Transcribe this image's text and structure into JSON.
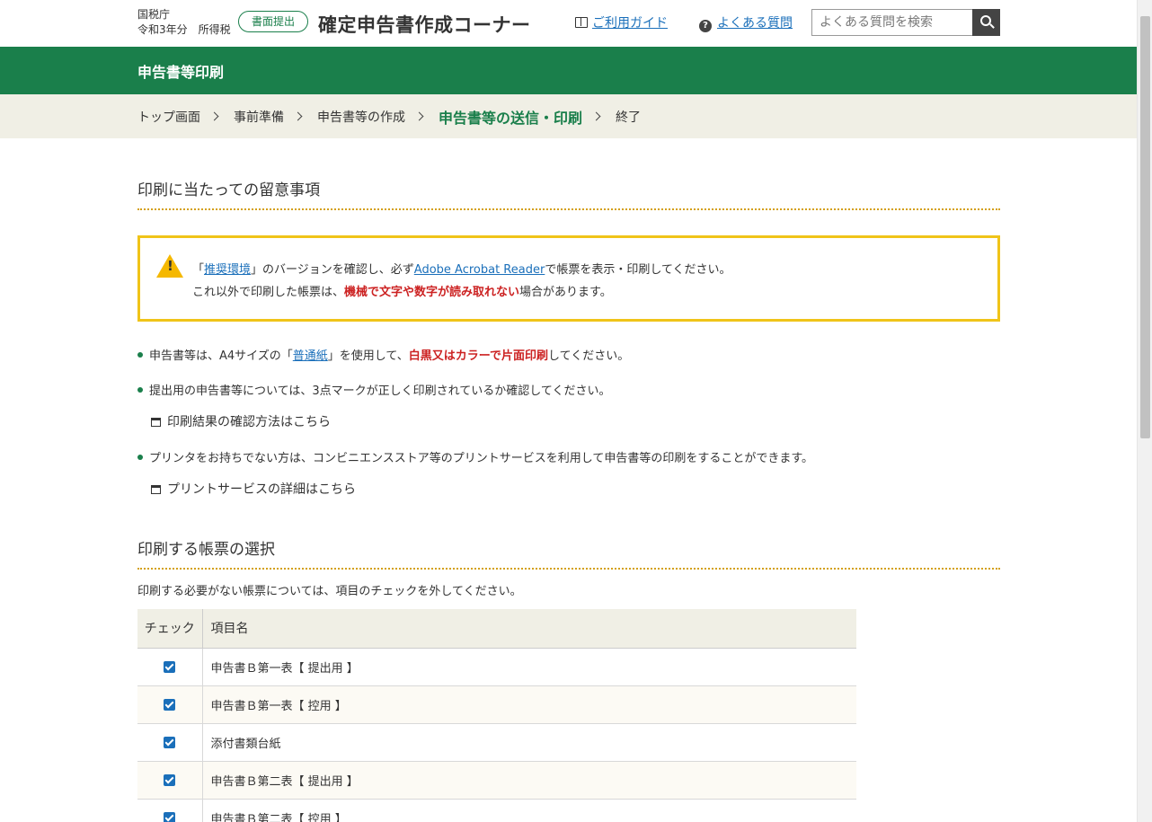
{
  "header": {
    "agency": "国税庁",
    "tax_year": "令和3年分　所得税",
    "mode_badge": "書面提出",
    "site_title": "確定申告書作成コーナー",
    "guide_link": "ご利用ガイド",
    "faq_link": "よくある質問",
    "search_placeholder": "よくある質問を検索"
  },
  "page_title": "申告書等印刷",
  "breadcrumb": [
    "トップ画面",
    "事前準備",
    "申告書等の作成",
    "申告書等の送信・印刷",
    "終了"
  ],
  "notes_section": {
    "title": "印刷に当たっての留意事項",
    "notice": {
      "l1_a": "「",
      "l1_link1": "推奨環境",
      "l1_b": "」のバージョンを確認し、必ず",
      "l1_link2": "Adobe Acrobat Reader",
      "l1_c": "で帳票を表示・印刷してください。",
      "l2_a": "これ以外で印刷した帳票は、",
      "l2_red": "機械で文字や数字が読み取れない",
      "l2_b": "場合があります。"
    },
    "bullet1": {
      "a": "申告書等は、A4サイズの「",
      "link": "普通紙",
      "b": "」を使用して、",
      "red": "白黒又はカラーで片面印刷",
      "c": "してください。"
    },
    "bullet2": "提出用の申告書等については、3点マークが正しく印刷されているか確認してください。",
    "link_confirm": "印刷結果の確認方法はこちら",
    "bullet3": "プリンタをお持ちでない方は、コンビニエンスストア等のプリントサービスを利用して申告書等の印刷をすることができます。",
    "link_print_service": "プリントサービスの詳細はこちら"
  },
  "select_section": {
    "title": "印刷する帳票の選択",
    "description": "印刷する必要がない帳票については、項目のチェックを外してください。",
    "columns": [
      "チェック",
      "項目名"
    ],
    "rows": [
      {
        "checked": true,
        "name": "申告書Ｂ第一表【 提出用 】"
      },
      {
        "checked": true,
        "name": "申告書Ｂ第一表【 控用 】"
      },
      {
        "checked": true,
        "name": "添付書類台紙"
      },
      {
        "checked": true,
        "name": "申告書Ｂ第二表【 提出用 】"
      },
      {
        "checked": true,
        "name": "申告書Ｂ第二表【 控用 】"
      }
    ]
  },
  "colors": {
    "primary_green": "#1a7f4b",
    "breadcrumb_bg": "#f0efe5",
    "notice_border": "#f0c419",
    "emphasis_red": "#cc2222",
    "link_blue": "#1a6fba"
  }
}
